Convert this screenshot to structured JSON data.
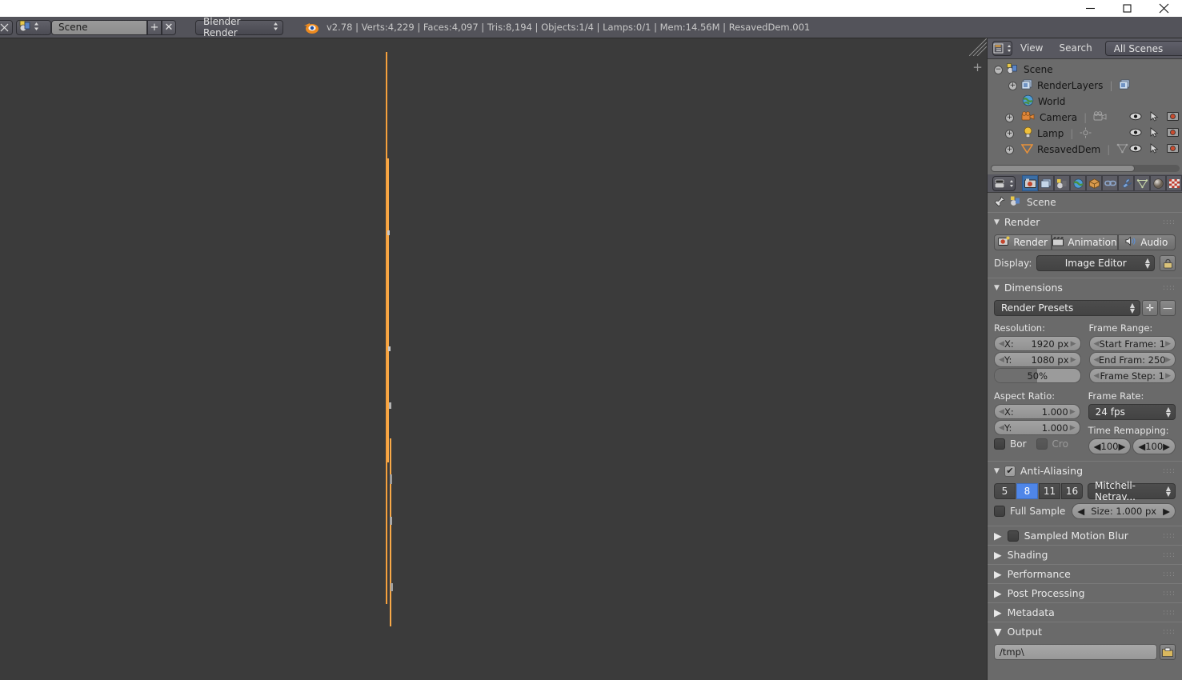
{
  "window": {
    "minimize_label": "minimize",
    "maximize_label": "maximize",
    "close_label": "close"
  },
  "topbar": {
    "scene_name": "Scene",
    "new_scene_label": "+",
    "delete_scene_label": "✕",
    "render_engine": "Blender Render",
    "stats": "v2.78 | Verts:4,229 | Faces:4,097 | Tris:8,194 | Objects:1/4 | Lamps:0/1 | Mem:14.56M | ResavedDem.001"
  },
  "outliner": {
    "menus": [
      "View",
      "Search"
    ],
    "display_mode": "All Scenes",
    "tree": [
      {
        "label": "Scene",
        "depth": 0,
        "expander": "−",
        "icon": "scene-icon",
        "extra_icon": "",
        "row_icons": []
      },
      {
        "label": "RenderLayers",
        "depth": 1,
        "expander": "+",
        "icon": "renderlayers-icon",
        "extra_icon": "renderlayers-icon",
        "row_icons": []
      },
      {
        "label": "World",
        "depth": 1,
        "expander": "",
        "icon": "world-icon",
        "extra_icon": "",
        "row_icons": []
      },
      {
        "label": "Camera",
        "depth": 1,
        "expander": "+",
        "icon": "camera-icon",
        "extra_icon": "camera-data-icon",
        "row_icons": [
          "eye-icon",
          "cursor-icon",
          "render-icon"
        ]
      },
      {
        "label": "Lamp",
        "depth": 1,
        "expander": "+",
        "icon": "lamp-icon",
        "extra_icon": "lamp-data-icon",
        "row_icons": [
          "eye-icon",
          "cursor-icon",
          "render-icon"
        ]
      },
      {
        "label": "ResavedDem",
        "depth": 1,
        "expander": "+",
        "icon": "mesh-object-icon",
        "extra_icon": "mesh-data-icon",
        "row_icons": [
          "eye-icon",
          "cursor-icon",
          "render-icon"
        ]
      }
    ]
  },
  "properties": {
    "tabs": [
      {
        "name": "render",
        "active": true
      },
      {
        "name": "render-layers",
        "active": false
      },
      {
        "name": "scene",
        "active": false
      },
      {
        "name": "world",
        "active": false
      },
      {
        "name": "object",
        "active": false
      },
      {
        "name": "constraints",
        "active": false
      },
      {
        "name": "modifiers",
        "active": false
      },
      {
        "name": "data",
        "active": false
      },
      {
        "name": "material",
        "active": false
      },
      {
        "name": "texture",
        "active": false
      }
    ],
    "breadcrumb": "Scene",
    "render_panel": {
      "title": "Render",
      "buttons": [
        "Render",
        "Animation",
        "Audio"
      ],
      "display_label": "Display:",
      "display_value": "Image Editor"
    },
    "dimensions_panel": {
      "title": "Dimensions",
      "preset_value": "Render Presets",
      "add_preset": "✛",
      "remove_preset": "—",
      "resolution_label": "Resolution:",
      "resolution_x_label": "X:",
      "resolution_x_value": "1920 px",
      "resolution_y_label": "Y:",
      "resolution_y_value": "1080 px",
      "resolution_percent": "50%",
      "frame_range_label": "Frame Range:",
      "start_frame": "Start Frame: 1",
      "end_frame": "End Fram: 250",
      "frame_step": "Frame Step:  1",
      "aspect_ratio_label": "Aspect Ratio:",
      "aspect_x_label": "X:",
      "aspect_x_value": "1.000",
      "aspect_y_label": "Y:",
      "aspect_y_value": "1.000",
      "border_label": "Bor",
      "crop_label": "Cro",
      "frame_rate_label": "Frame Rate:",
      "frame_rate_value": "24 fps",
      "time_remapping_label": "Time Remapping:",
      "time_remap_old": "100",
      "time_remap_new": "100"
    },
    "antialiasing_panel": {
      "title": "Anti-Aliasing",
      "enabled": true,
      "samples": [
        "5",
        "8",
        "11",
        "16"
      ],
      "samples_active": "8",
      "filter_value": "Mitchell-Netrav...",
      "full_sample_label": "Full Sample",
      "full_sample_on": false,
      "size_value": "Size: 1.000 px"
    },
    "collapsed_panels": [
      {
        "title": "Sampled Motion Blur",
        "has_checkbox": true
      },
      {
        "title": "Shading",
        "has_checkbox": false
      },
      {
        "title": "Performance",
        "has_checkbox": false
      },
      {
        "title": "Post Processing",
        "has_checkbox": false
      },
      {
        "title": "Metadata",
        "has_checkbox": false
      }
    ],
    "output_panel": {
      "title": "Output",
      "path_value": "/tmp\\",
      "browse_icon": "folder-icon"
    }
  },
  "viewport": {
    "background_color": "#3b3b3b",
    "object_color": "#f5a03c",
    "object_name": "ResavedDem"
  }
}
